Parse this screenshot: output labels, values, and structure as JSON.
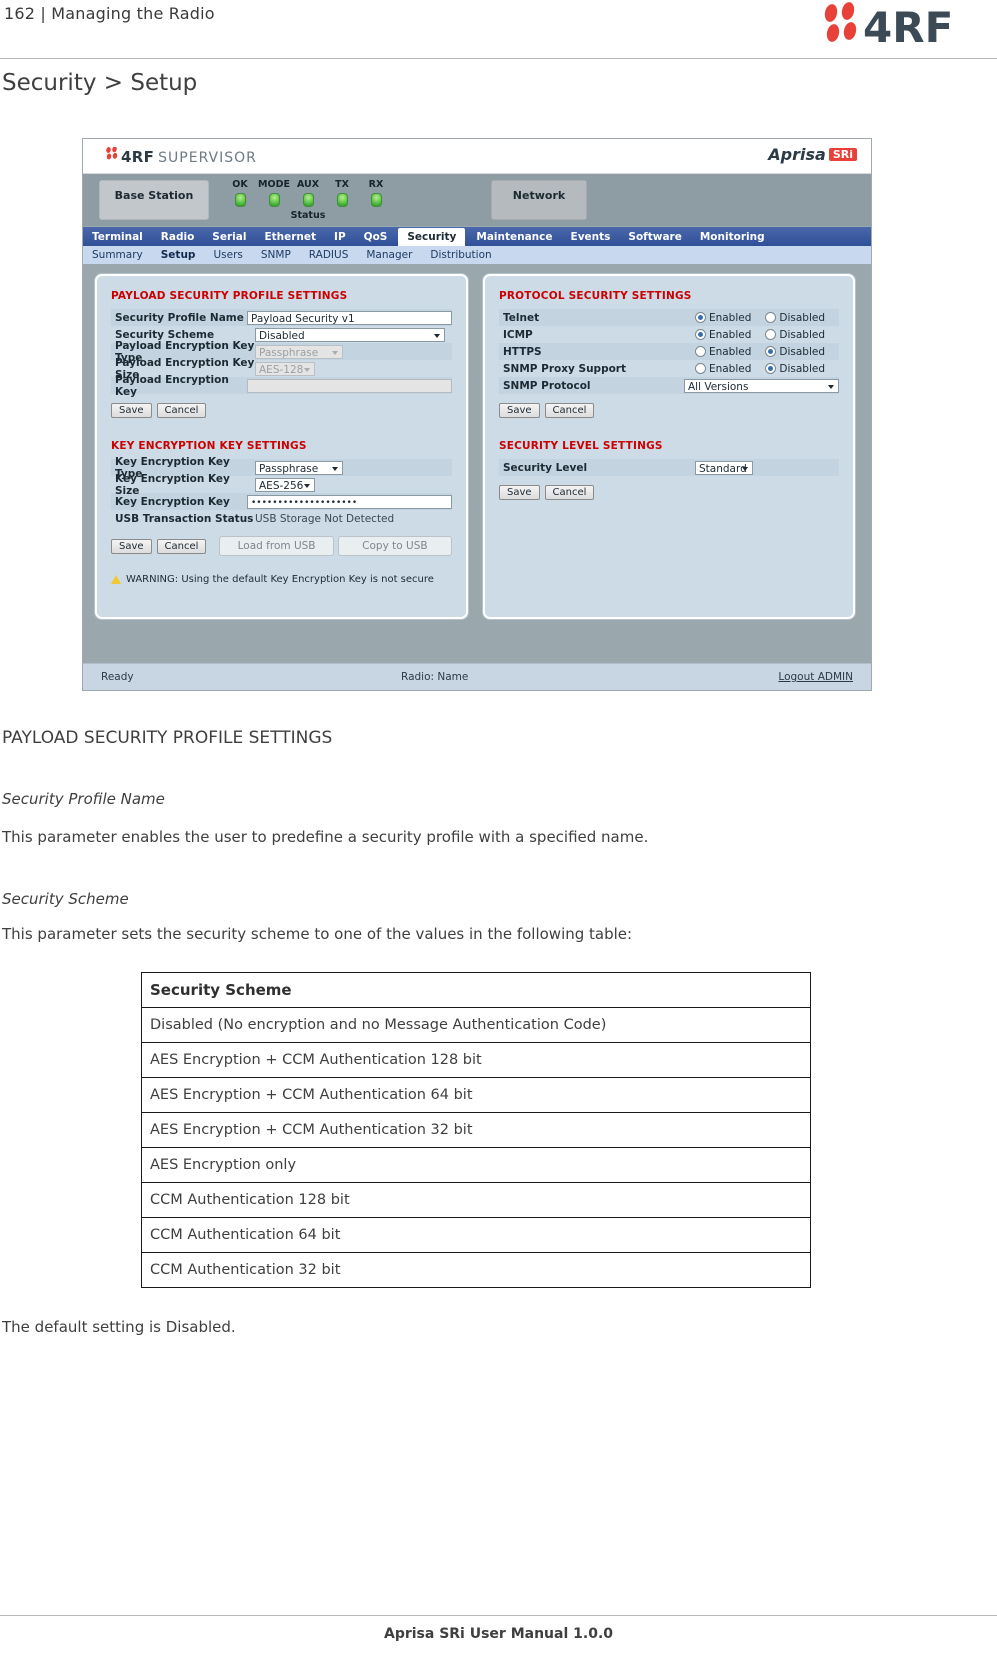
{
  "page": {
    "header_left": "162  |  Managing the Radio",
    "logo_text": "4RF",
    "chapter_title": "Security > Setup",
    "footer": "Aprisa SRi User Manual 1.0.0"
  },
  "screenshot": {
    "brand": {
      "name": "4RF",
      "product": "SUPERVISOR",
      "right_brand": "Aprisa",
      "right_badge": "SRi"
    },
    "status": {
      "station_label": "Base Station",
      "network_label": "Network",
      "status_caption": "Status",
      "leds": [
        "OK",
        "MODE",
        "AUX",
        "TX",
        "RX"
      ]
    },
    "main_tabs": [
      {
        "label": "Terminal",
        "active": false
      },
      {
        "label": "Radio",
        "active": false
      },
      {
        "label": "Serial",
        "active": false
      },
      {
        "label": "Ethernet",
        "active": false
      },
      {
        "label": "IP",
        "active": false
      },
      {
        "label": "QoS",
        "active": false
      },
      {
        "label": "Security",
        "active": true
      },
      {
        "label": "Maintenance",
        "active": false
      },
      {
        "label": "Events",
        "active": false
      },
      {
        "label": "Software",
        "active": false
      },
      {
        "label": "Monitoring",
        "active": false
      }
    ],
    "sub_tabs": [
      {
        "label": "Summary",
        "active": false
      },
      {
        "label": "Setup",
        "active": true
      },
      {
        "label": "Users",
        "active": false
      },
      {
        "label": "SNMP",
        "active": false
      },
      {
        "label": "RADIUS",
        "active": false
      },
      {
        "label": "Manager",
        "active": false
      },
      {
        "label": "Distribution",
        "active": false
      }
    ],
    "payload_profile": {
      "title": "PAYLOAD SECURITY PROFILE SETTINGS",
      "profile_name_label": "Security Profile Name",
      "profile_name_value": "Payload Security v1",
      "scheme_label": "Security Scheme",
      "scheme_value": "Disabled",
      "key_type_label": "Payload Encryption Key Type",
      "key_type_value": "Passphrase",
      "key_size_label": "Payload Encryption Key Size",
      "key_size_value": "AES-128",
      "key_label": "Payload Encryption Key",
      "key_value": "",
      "save_label": "Save",
      "cancel_label": "Cancel"
    },
    "kek": {
      "title": "KEY ENCRYPTION KEY SETTINGS",
      "type_label": "Key Encryption Key Type",
      "type_value": "Passphrase",
      "size_label": "Key Encryption Key Size",
      "size_value": "AES-256",
      "key_label": "Key Encryption Key",
      "key_value": "••••••••••••••••••••",
      "usb_status_label": "USB Transaction Status",
      "usb_status_value": "USB Storage Not Detected",
      "save_label": "Save",
      "cancel_label": "Cancel",
      "load_usb_label": "Load from USB",
      "copy_usb_label": "Copy to USB",
      "warning": "WARNING: Using the default Key Encryption Key is not secure"
    },
    "protocol": {
      "title": "PROTOCOL SECURITY SETTINGS",
      "enabled_label": "Enabled",
      "disabled_label": "Disabled",
      "rows": [
        {
          "label": "Telnet",
          "value": "Enabled"
        },
        {
          "label": "ICMP",
          "value": "Enabled"
        },
        {
          "label": "HTTPS",
          "value": "Disabled"
        },
        {
          "label": "SNMP Proxy Support",
          "value": "Disabled"
        }
      ],
      "snmp_protocol_label": "SNMP Protocol",
      "snmp_protocol_value": "All Versions",
      "save_label": "Save",
      "cancel_label": "Cancel"
    },
    "security_level": {
      "title": "SECURITY LEVEL SETTINGS",
      "level_label": "Security Level",
      "level_value": "Standard",
      "save_label": "Save",
      "cancel_label": "Cancel"
    },
    "footer": {
      "status": "Ready",
      "radio": "Radio: Name",
      "logout": "Logout ADMIN"
    }
  },
  "doc": {
    "section_heading": "PAYLOAD SECURITY PROFILE SETTINGS",
    "sub1_heading": "Security Profile Name",
    "sub1_body": "This parameter enables the user to predefine a security profile with a specified name.",
    "sub2_heading": "Security Scheme",
    "sub2_body": "This parameter sets the security scheme to one of the values in the following table:",
    "closing": "The default setting is Disabled.",
    "table": {
      "header": "Security Scheme",
      "rows": [
        "Disabled (No encryption and no Message Authentication Code)",
        "AES Encryption + CCM Authentication 128 bit",
        "AES Encryption + CCM Authentication 64 bit",
        "AES Encryption + CCM Authentication 32 bit",
        "AES Encryption only",
        "CCM Authentication 128 bit",
        "CCM Authentication 64 bit",
        "CCM Authentication 32 bit"
      ]
    }
  },
  "colors": {
    "brand_red": "#e8413a",
    "section_red": "#cc0000",
    "nav_blue": "#3f5fa8"
  }
}
